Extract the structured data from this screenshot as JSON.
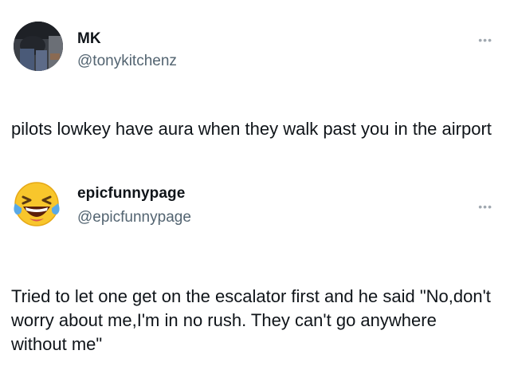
{
  "tweets": [
    {
      "display_name": "MK",
      "handle": "@tonykitchenz",
      "text": "pilots lowkey have aura when they walk past you in the airport",
      "more_icon": "more-horizontal-icon"
    },
    {
      "display_name": "epicfunnypage",
      "handle": "@epicfunnypage",
      "avatar_icon": "laughing-tears-emoji-icon",
      "text": "Tried to let one get on the escalator first and he said \"No,don't worry about me,I'm in no rush. They can't go anywhere without me\"",
      "more_icon": "more-horizontal-icon"
    }
  ],
  "colors": {
    "text": "#0f1419",
    "handle": "#536471",
    "emoji_face": "#f8c62c",
    "emoji_tears": "#5aa9e6"
  }
}
